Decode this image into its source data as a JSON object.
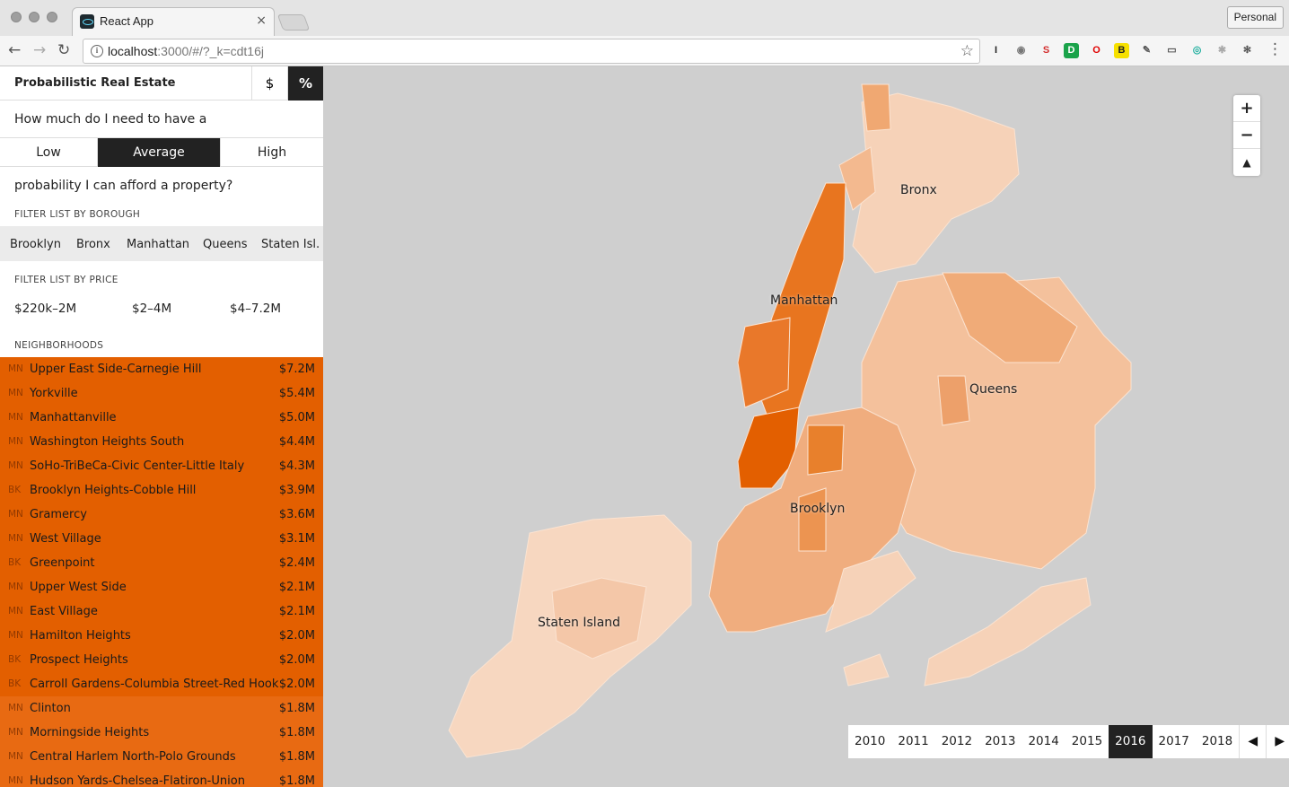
{
  "browser": {
    "tab_title": "React App",
    "tab_close": "×",
    "url_host": "localhost",
    "url_rest": ":3000/#/?_k=cdt16j",
    "profile": "Personal",
    "nav": {
      "back": "←",
      "forward": "→",
      "reload": "↻"
    },
    "star": "☆",
    "info": "i",
    "menu": "⋮",
    "extensions": [
      {
        "glyph": "I",
        "color": "#222222",
        "bg": "#f5f5f5"
      },
      {
        "glyph": "◉",
        "color": "#777777",
        "bg": "#f5f5f5"
      },
      {
        "glyph": "S",
        "color": "#d32f2f",
        "bg": "#f5f5f5"
      },
      {
        "glyph": "D",
        "color": "#ffffff",
        "bg": "#1aa34a"
      },
      {
        "glyph": "O",
        "color": "#e00000",
        "bg": "#f5f5f5"
      },
      {
        "glyph": "B",
        "color": "#222222",
        "bg": "#f6e000"
      },
      {
        "glyph": "✎",
        "color": "#555555",
        "bg": "#f5f5f5"
      },
      {
        "glyph": "▭",
        "color": "#555555",
        "bg": "#f5f5f5"
      },
      {
        "glyph": "◎",
        "color": "#23b0a0",
        "bg": "#f5f5f5"
      },
      {
        "glyph": "✱",
        "color": "#aaaaaa",
        "bg": "#f5f5f5"
      },
      {
        "glyph": "✻",
        "color": "#555555",
        "bg": "#f5f5f5"
      }
    ]
  },
  "app": {
    "title": "Probabilistic Real Estate",
    "unit_dollar": "$",
    "unit_percent": "%",
    "question_start": "How much do I need to have a",
    "levels": [
      "Low",
      "Average",
      "High"
    ],
    "active_level": "Average",
    "question_end": "probability I can afford a property?",
    "filter_borough_label": "FILTER LIST BY BOROUGH",
    "boroughs": [
      "Brooklyn",
      "Bronx",
      "Manhattan",
      "Queens",
      "Staten Isl."
    ],
    "filter_price_label": "FILTER LIST BY PRICE",
    "prices": [
      "$220k–2M",
      "$2–4M",
      "$4–7.2M"
    ],
    "neighborhoods_label": "NEIGHBORHOODS",
    "accent_color": "#e35f00",
    "neighborhoods": [
      {
        "borough": "MN",
        "name": "Upper East Side-Carnegie Hill",
        "value": "$7.2M",
        "color": "#e35f00"
      },
      {
        "borough": "MN",
        "name": "Yorkville",
        "value": "$5.4M",
        "color": "#e35f00"
      },
      {
        "borough": "MN",
        "name": "Manhattanville",
        "value": "$5.0M",
        "color": "#e35f00"
      },
      {
        "borough": "MN",
        "name": "Washington Heights South",
        "value": "$4.4M",
        "color": "#e35f00"
      },
      {
        "borough": "MN",
        "name": "SoHo-TriBeCa-Civic Center-Little Italy",
        "value": "$4.3M",
        "color": "#e35f00"
      },
      {
        "borough": "BK",
        "name": "Brooklyn Heights-Cobble Hill",
        "value": "$3.9M",
        "color": "#e35f00"
      },
      {
        "borough": "MN",
        "name": "Gramercy",
        "value": "$3.6M",
        "color": "#e35f00"
      },
      {
        "borough": "MN",
        "name": "West Village",
        "value": "$3.1M",
        "color": "#e35f00"
      },
      {
        "borough": "BK",
        "name": "Greenpoint",
        "value": "$2.4M",
        "color": "#e35f00"
      },
      {
        "borough": "MN",
        "name": "Upper West Side",
        "value": "$2.1M",
        "color": "#e35f00"
      },
      {
        "borough": "MN",
        "name": "East Village",
        "value": "$2.1M",
        "color": "#e35f00"
      },
      {
        "borough": "MN",
        "name": "Hamilton Heights",
        "value": "$2.0M",
        "color": "#e35f00"
      },
      {
        "borough": "BK",
        "name": "Prospect Heights",
        "value": "$2.0M",
        "color": "#e35f00"
      },
      {
        "borough": "BK",
        "name": "Carroll Gardens-Columbia Street-Red Hook",
        "value": "$2.0M",
        "color": "#e35f00"
      },
      {
        "borough": "MN",
        "name": "Clinton",
        "value": "$1.8M",
        "color": "#e86a12"
      },
      {
        "borough": "MN",
        "name": "Morningside Heights",
        "value": "$1.8M",
        "color": "#e86a12"
      },
      {
        "borough": "MN",
        "name": "Central Harlem North-Polo Grounds",
        "value": "$1.8M",
        "color": "#e86a12"
      },
      {
        "borough": "MN",
        "name": "Hudson Yards-Chelsea-Flatiron-Union",
        "value": "$1.8M",
        "color": "#e86a12"
      }
    ]
  },
  "map": {
    "labels": [
      {
        "text": "Bronx",
        "id": "bronx"
      },
      {
        "text": "Manhattan",
        "id": "manhattan"
      },
      {
        "text": "Queens",
        "id": "queens"
      },
      {
        "text": "Brooklyn",
        "id": "brooklyn"
      },
      {
        "text": "Staten Island",
        "id": "staten-island"
      }
    ],
    "zoom_in": "+",
    "zoom_out": "−",
    "compass": "▲",
    "years": [
      "2010",
      "2011",
      "2012",
      "2013",
      "2014",
      "2015",
      "2016",
      "2017",
      "2018"
    ],
    "active_year": "2016",
    "prev": "◀",
    "next": "▶"
  }
}
